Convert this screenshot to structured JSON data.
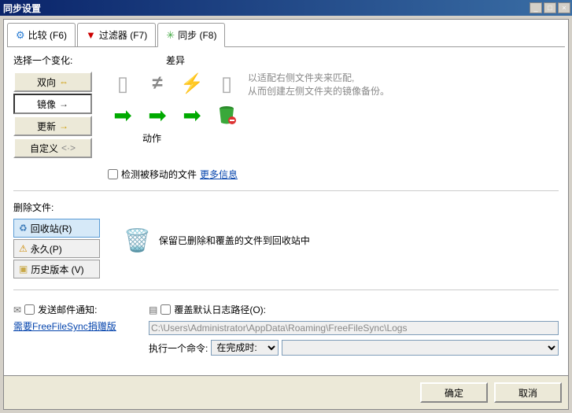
{
  "window": {
    "title": "同步设置"
  },
  "tabs": {
    "compare": "比较 (F6)",
    "filter": "过滤器 (F7)",
    "sync": "同步 (F8)"
  },
  "variant": {
    "label": "选择一个变化:",
    "twoway": "双向",
    "mirror": "镜像",
    "update": "更新",
    "custom": "自定义"
  },
  "diff": {
    "label": "差异",
    "action": "动作",
    "desc1": "以适配右侧文件夹来匹配,",
    "desc2": "从而创建左侧文件夹的镜像备份。"
  },
  "detect": {
    "label": "检测被移动的文件",
    "more": "更多信息"
  },
  "del": {
    "label": "删除文件:",
    "recycle": "回收站(R)",
    "perm": "永久(P)",
    "hist": "历史版本 (V)",
    "desc": "保留已删除和覆盖的文件到回收站中"
  },
  "email": {
    "label": "发送邮件通知:",
    "link": "需要FreeFileSync捐赠版"
  },
  "log": {
    "label": "覆盖默认日志路径(O):",
    "path": "C:\\Users\\Administrator\\AppData\\Roaming\\FreeFileSync\\Logs"
  },
  "cmd": {
    "label": "执行一个命令:",
    "when": "在完成时:"
  },
  "footer": {
    "ok": "确定",
    "cancel": "取消"
  },
  "colors": {
    "accent": "#0a246a"
  }
}
